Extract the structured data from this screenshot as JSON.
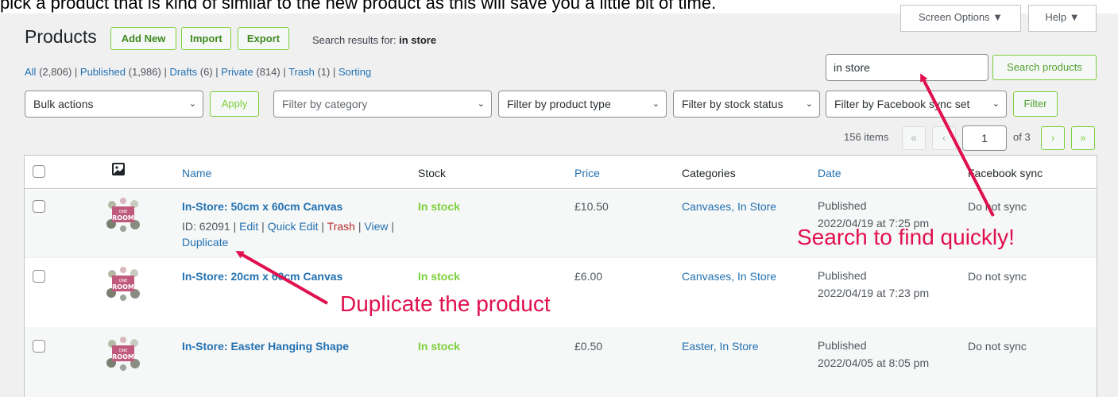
{
  "intro_text": "pick a product that is kind of similar to the new product as this will save you a little bit of time.",
  "top_buttons": {
    "screen_options": "Screen Options ▼",
    "help": "Help ▼"
  },
  "header": {
    "title": "Products",
    "add_new": "Add New",
    "import": "Import",
    "export": "Export",
    "search_results_prefix": "Search results for: ",
    "search_term": "in store"
  },
  "views": [
    {
      "label": "All",
      "count": "(2,806)"
    },
    {
      "label": "Published",
      "count": "(1,986)"
    },
    {
      "label": "Drafts",
      "count": "(6)"
    },
    {
      "label": "Private",
      "count": "(814)"
    },
    {
      "label": "Trash",
      "count": "(1)"
    },
    {
      "label": "Sorting",
      "count": ""
    }
  ],
  "search": {
    "value": "in store",
    "button": "Search products"
  },
  "filters": {
    "bulk_actions": "Bulk actions",
    "apply": "Apply",
    "category": "Filter by category",
    "product_type": "Filter by product type",
    "stock_status": "Filter by stock status",
    "facebook_sync": "Filter by Facebook sync set",
    "filter_button": "Filter"
  },
  "pagination": {
    "items": "156 items",
    "first": "«",
    "prev": "‹",
    "current_page": "1",
    "of_pages": "of 3",
    "next": "›",
    "last": "»"
  },
  "columns": {
    "name": "Name",
    "stock": "Stock",
    "price": "Price",
    "categories": "Categories",
    "date": "Date",
    "facebook_sync": "Facebook sync"
  },
  "rows": [
    {
      "name": "In-Store: 50cm x 60cm Canvas",
      "stock": "In stock",
      "price": "£10.50",
      "categories": "Canvases, In Store",
      "status": "Published",
      "date": "2022/04/19 at 7:25 pm",
      "sync": "Do not sync",
      "id_label": "ID: 62091",
      "actions": {
        "edit": "Edit",
        "quick_edit": "Quick Edit",
        "trash": "Trash",
        "view": "View",
        "duplicate": "Duplicate"
      }
    },
    {
      "name": "In-Store: 20cm x 60cm Canvas",
      "stock": "In stock",
      "price": "£6.00",
      "categories": "Canvases, In Store",
      "status": "Published",
      "date": "2022/04/19 at 7:23 pm",
      "sync": "Do not sync"
    },
    {
      "name": "In-Store: Easter Hanging Shape",
      "stock": "In stock",
      "price": "£0.50",
      "categories": "Easter, In Store",
      "status": "Published",
      "date": "2022/04/05 at 8:05 pm",
      "sync": "Do not sync"
    }
  ],
  "thumbnail_text": {
    "line1": "ONE",
    "line2": "ROOM"
  },
  "annotations": {
    "search": "Search to find quickly!",
    "duplicate": "Duplicate the product",
    "color": "#e0104f"
  },
  "colors": {
    "accent_green": "#7ad03a",
    "link_blue": "#2271b1",
    "trash_red": "#b32d2e"
  },
  "icons": {
    "sort": "sort-icon",
    "image_column": "image-column-icon",
    "chevron": "chevron-down-icon"
  }
}
